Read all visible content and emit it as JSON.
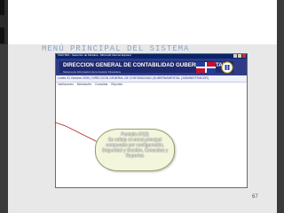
{
  "slide": {
    "title": "MENÚ PRINCIPAL DEL SISTEMA",
    "page_number": "67"
  },
  "window": {
    "titlebar": "SIGCTEN - Selección de Módulos - Microsoft Internet Explorer",
    "header_title": "DIRECCION GENERAL DE CONTABILIDAD GUBERNAMENTAL",
    "header_subtitle": "Sistema de Información de la Gestión Financiera",
    "info_line": "Lunes 31 Octubre 2005 | DIRECCION GENERAL DE CONTABILIDAD (GUBERNAMENTAL | ADMINISTRADOR)",
    "menu": [
      "Instituciones",
      "Módulos/es",
      "Consultas",
      "Reportes"
    ]
  },
  "callout": {
    "text": "Pantalla 67(2)\nSe refleja el menú principal compuesto por configuración, Seguridad y Gestión, Consultas y Reportes"
  },
  "colors": {
    "header": "#2e3c87",
    "title_text": "#8aa6c8",
    "callout_fill": "#f3f6dc"
  }
}
